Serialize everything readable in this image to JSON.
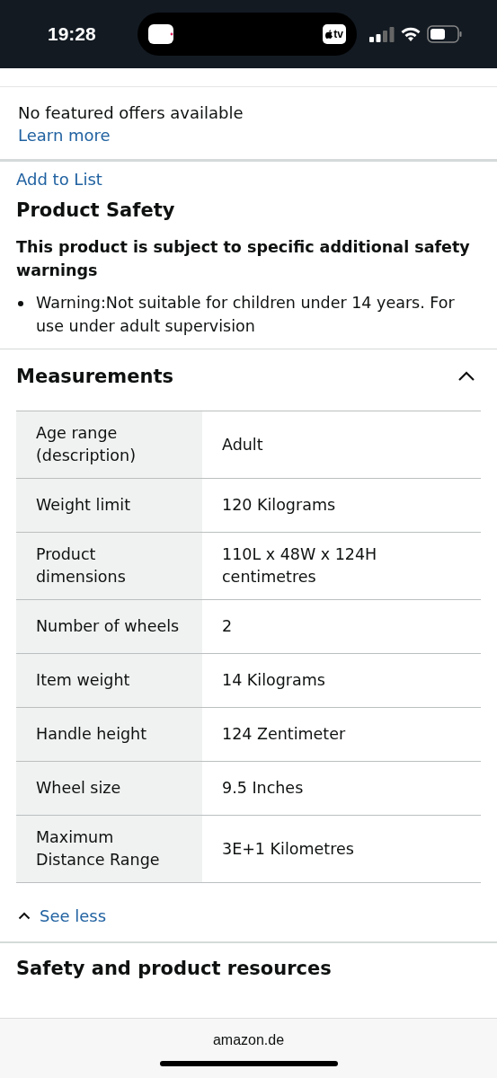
{
  "status_bar": {
    "time": "19:28",
    "app_badge": "tv"
  },
  "offers": {
    "message": "No featured offers available",
    "link": "Learn more"
  },
  "add_to_list": "Add to List",
  "product_safety": {
    "title": "Product Safety",
    "warning_title": "This product is subject to specific additional safety warnings",
    "bullets": [
      "Warning:Not suitable for children under 14 years. For use under adult supervision"
    ]
  },
  "measurements": {
    "title": "Measurements",
    "expanded": true,
    "rows": [
      {
        "label": "Age range (description)",
        "value": "Adult"
      },
      {
        "label": "Weight limit",
        "value": "120 Kilograms"
      },
      {
        "label": "Product dimensions",
        "value": "110L x 48W x 124H centimetres"
      },
      {
        "label": "Number of wheels",
        "value": "2"
      },
      {
        "label": "Item weight",
        "value": "14 Kilograms"
      },
      {
        "label": "Handle height",
        "value": "124 Zentimeter"
      },
      {
        "label": "Wheel size",
        "value": "9.5 Inches"
      },
      {
        "label": "Maximum Distance Range",
        "value": "3E+1 Kilometres"
      }
    ],
    "see_less": "See less"
  },
  "next_section": {
    "title": "Safety and product resources"
  },
  "address_bar": {
    "domain": "amazon.de"
  }
}
